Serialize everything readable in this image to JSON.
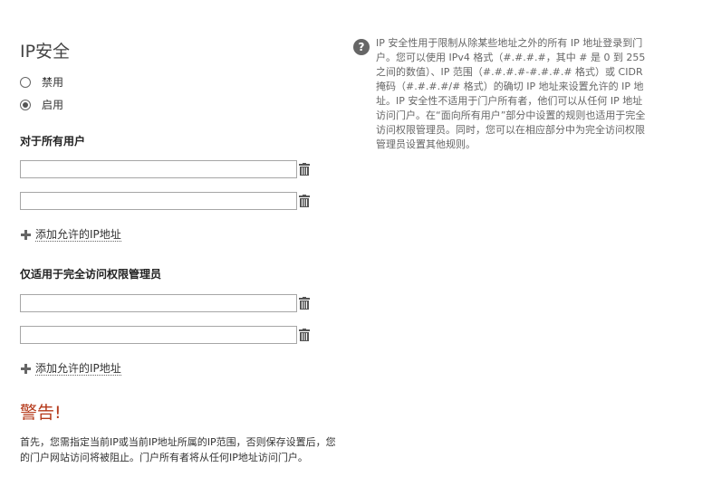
{
  "title": "IP安全",
  "options": {
    "disable": {
      "label": "禁用",
      "checked": false
    },
    "enable": {
      "label": "启用",
      "checked": true
    }
  },
  "all_users": {
    "label": "对于所有用户",
    "inputs": [
      {
        "value": "",
        "icon": "trash-icon"
      },
      {
        "value": "",
        "icon": "trash-icon"
      }
    ],
    "add_label": "添加允许的IP地址"
  },
  "admins": {
    "label": "仅适用于完全访问权限管理员",
    "inputs": [
      {
        "value": "",
        "icon": "trash-icon"
      },
      {
        "value": "",
        "icon": "trash-icon"
      }
    ],
    "add_label": "添加允许的IP地址"
  },
  "warning": {
    "title": "警告!",
    "text": "首先，您需指定当前IP或当前IP地址所属的IP范围，否则保存设置后，您的门户网站访问将被阻止。门户所有者将从任何IP地址访问门户。"
  },
  "help": {
    "icon_glyph": "?",
    "text": "IP 安全性用于限制从除某些地址之外的所有 IP 地址登录到门户。您可以使用 IPv4 格式（#.#.#.#，其中 # 是 0 到 255 之间的数值）、IP 范围（#.#.#.#-#.#.#.# 格式）或 CIDR 掩码（#.#.#.#/# 格式）的确切 IP 地址来设置允许的 IP 地址。IP 安全性不适用于门户所有者，他们可以从任何 IP 地址访问门户。在“面向所有用户”部分中设置的规则也适用于完全访问权限管理员。同时，您可以在相应部分中为完全访问权限管理员设置其他规则。"
  },
  "colors": {
    "warning": "#b5391a",
    "help_icon": "#666666"
  }
}
